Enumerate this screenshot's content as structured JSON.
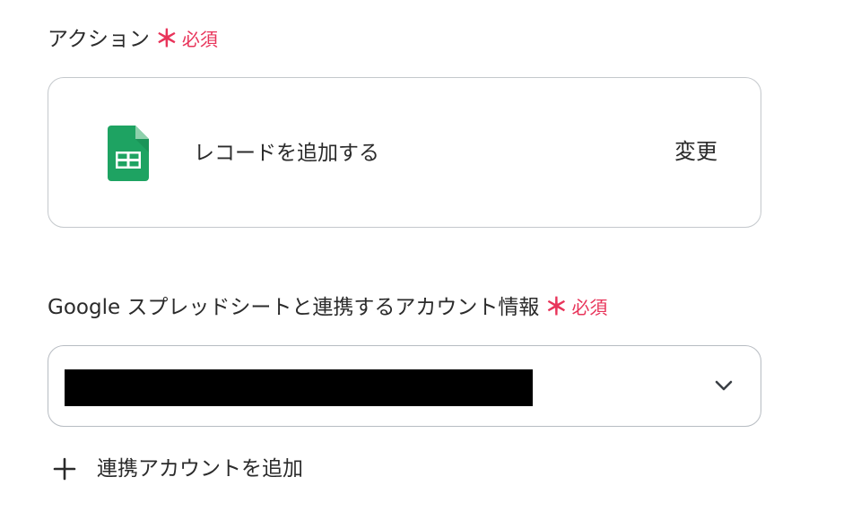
{
  "action": {
    "label": "アクション",
    "required_mark": "＊",
    "required_text": "必須",
    "card": {
      "icon": "google-sheets-icon",
      "name": "レコードを追加する",
      "change_label": "変更"
    }
  },
  "account": {
    "label": "Google スプレッドシートと連携するアカウント情報",
    "required_mark": "＊",
    "required_text": "必須",
    "selected_value": "",
    "dropdown_icon": "chevron-down-icon"
  },
  "add_account": {
    "icon": "plus-icon",
    "label": "連携アカウントを追加"
  },
  "colors": {
    "required": "#e8345a",
    "sheets_green": "#1ea362",
    "border": "#c4c8cc"
  }
}
